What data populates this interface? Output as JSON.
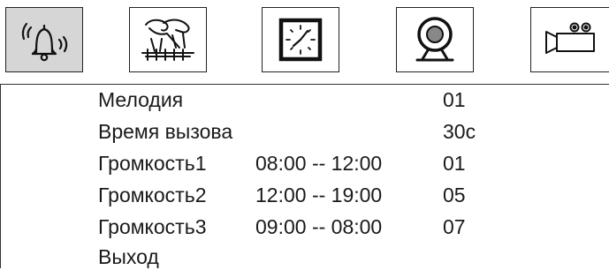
{
  "toolbar": {
    "buttons": [
      {
        "icon": "bell-icon",
        "active": true
      },
      {
        "icon": "keys-icon",
        "active": false
      },
      {
        "icon": "clock-icon",
        "active": false
      },
      {
        "icon": "camera-eye-icon",
        "active": false
      },
      {
        "icon": "video-camera-icon",
        "active": false
      }
    ]
  },
  "menu": {
    "rows": [
      {
        "label": "Мелодия",
        "range": "",
        "value": "01"
      },
      {
        "label": "Время вызова",
        "range": "",
        "value": "30с"
      },
      {
        "label": "Громкость1",
        "range": "08:00 -- 12:00",
        "value": "01"
      },
      {
        "label": "Громкость2",
        "range": "12:00 -- 19:00",
        "value": "05"
      },
      {
        "label": "Громкость3",
        "range": "09:00 -- 08:00",
        "value": "07"
      },
      {
        "label": "Выход",
        "range": "",
        "value": ""
      }
    ]
  },
  "colors": {
    "active_button_bg": "#d6d6d6",
    "text": "#1a1a1a",
    "border": "#222222"
  }
}
